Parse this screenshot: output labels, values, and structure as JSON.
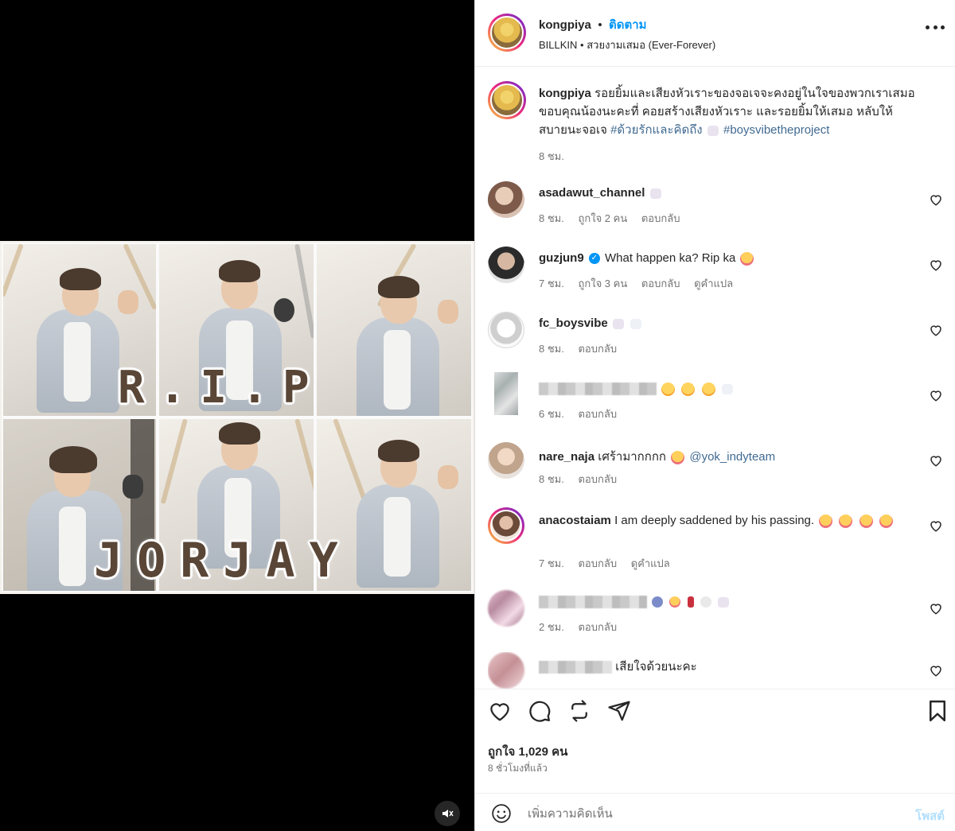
{
  "post": {
    "image_text": {
      "line1": "R.I.P",
      "line2": "JORJAY"
    },
    "mute_icon": "speaker-muted-icon"
  },
  "header": {
    "username": "kongpiya",
    "separator": "•",
    "follow_label": "ติดตาม",
    "audio_artist": "BILLKIN",
    "audio_separator": "•",
    "audio_title": "สวยงามเสมอ (Ever-Forever)",
    "more_icon": "more-options-icon"
  },
  "caption": {
    "username": "kongpiya",
    "text": "รอยยิ้มและเสียงหัวเราะของจอเจจะคงอยู่ในใจของพวกเราเสมอ ขอบคุณน้องนะคะที่ คอยสร้างเสียงหัวเราะ และรอยยิ้มให้เสมอ หลับให้สบายนะจอเจ",
    "hashtag1": "#ด้วยรักและคิดถึง",
    "hashtag2": "#boysvibetheproject",
    "time": "8 ชม."
  },
  "comments": [
    {
      "username": "asadawut_channel",
      "text": "",
      "time": "8 ชม.",
      "likes": "ถูกใจ 2 คน",
      "reply": "ตอบกลับ",
      "translate": ""
    },
    {
      "username": "guzjun9",
      "text": "What happen ka? Rip ka",
      "time": "7 ชม.",
      "likes": "ถูกใจ 3 คน",
      "reply": "ตอบกลับ",
      "translate": "ดูคำแปล"
    },
    {
      "username": "fc_boysvibe",
      "text": "",
      "time": "8 ชม.",
      "likes": "",
      "reply": "ตอบกลับ",
      "translate": ""
    },
    {
      "username": "",
      "text": "",
      "time": "6 ชม.",
      "likes": "",
      "reply": "ตอบกลับ",
      "translate": ""
    },
    {
      "username": "nare_naja",
      "text": "เศร้ามากกกก",
      "mention": "@yok_indyteam",
      "time": "8 ชม.",
      "likes": "",
      "reply": "ตอบกลับ",
      "translate": ""
    },
    {
      "username": "anacostaiam",
      "text": "I am deeply saddened by his passing.",
      "time": "7 ชม.",
      "likes": "",
      "reply": "ตอบกลับ",
      "translate": "ดูคำแปล"
    },
    {
      "username": "",
      "text": "",
      "time": "2 ชม.",
      "likes": "",
      "reply": "ตอบกลับ",
      "translate": ""
    },
    {
      "username": "",
      "text": "เสียใจด้วยนะคะ",
      "time": "",
      "likes": "",
      "reply": "",
      "translate": ""
    }
  ],
  "actions": {
    "likes_label": "ถูกใจ 1,029 คน",
    "posted_ago": "8 ชั่วโมงที่แล้ว",
    "comment_placeholder": "เพิ่มความคิดเห็น",
    "post_label": "โพสต์"
  },
  "colors": {
    "accent": "#0095f6",
    "text": "#262626",
    "muted": "#737373",
    "post_disabled": "#b2dffc"
  }
}
